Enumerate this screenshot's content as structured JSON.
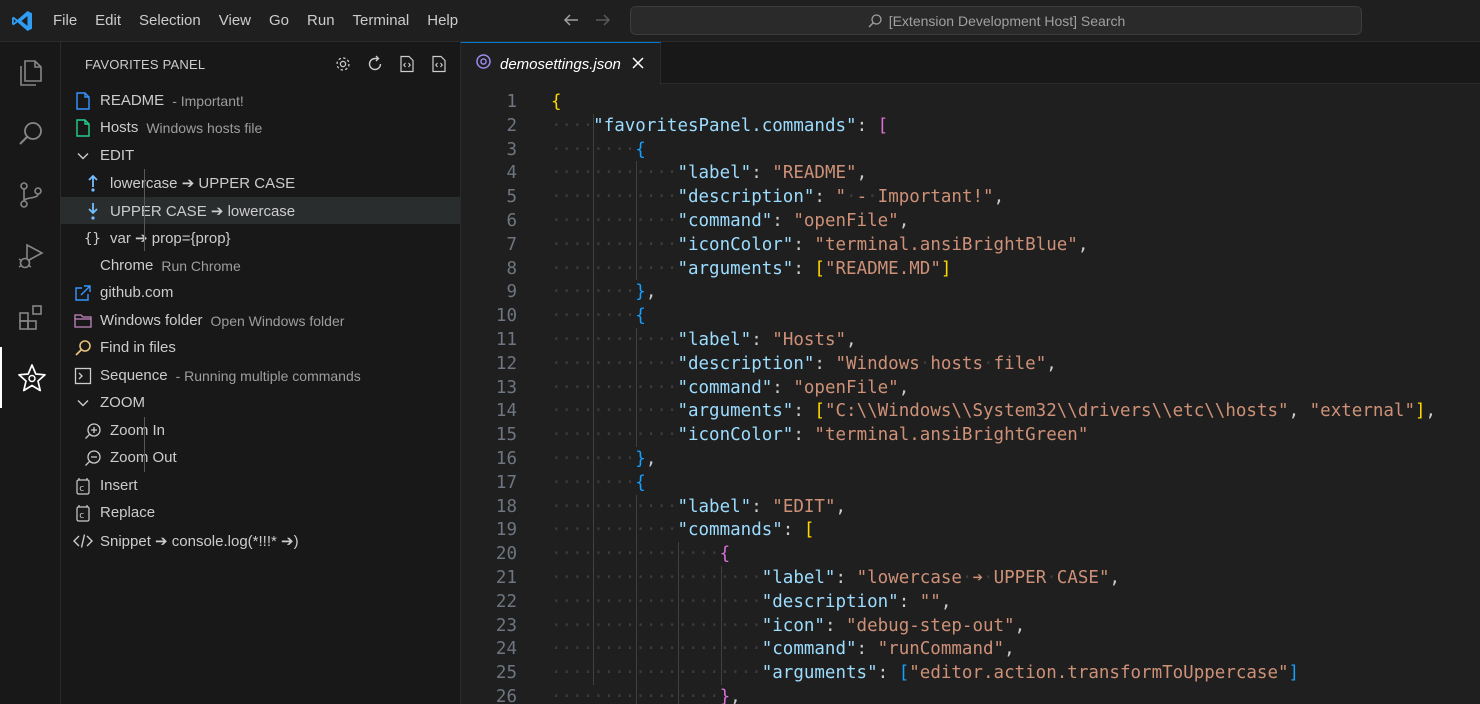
{
  "menu": [
    "File",
    "Edit",
    "Selection",
    "View",
    "Go",
    "Run",
    "Terminal",
    "Help"
  ],
  "search": {
    "placeholder": "[Extension Development Host] Search"
  },
  "activity_bar": [
    "explorer-icon",
    "search-icon",
    "source-control-icon",
    "run-debug-icon",
    "extensions-icon",
    "favorites-star-icon"
  ],
  "sidebar": {
    "title": "FAVORITES PANEL",
    "actions": [
      "gear-icon",
      "refresh-icon",
      "json-file-icon",
      "json-file-alt-icon"
    ],
    "items": [
      {
        "label": "README",
        "description": "- Important!",
        "icon": "file-icon",
        "color": "#3794ff"
      },
      {
        "label": "Hosts",
        "description": "Windows hosts file",
        "icon": "file-icon",
        "color": "#23d18b"
      },
      {
        "label": "EDIT",
        "description": "",
        "icon": "chevron-down-icon"
      },
      {
        "label": "lowercase ➔ UPPER CASE",
        "description": "",
        "icon": "debug-step-out-icon"
      },
      {
        "label": "UPPER CASE ➔ lowercase",
        "description": "",
        "icon": "debug-step-into-icon"
      },
      {
        "label": "var ➔ prop={prop}",
        "description": "",
        "icon": "braces-icon"
      },
      {
        "label": "Chrome",
        "description": "Run Chrome",
        "icon": ""
      },
      {
        "label": "github.com",
        "description": "",
        "icon": "link-external-icon"
      },
      {
        "label": "Windows folder",
        "description": "Open Windows folder",
        "icon": "folder-icon"
      },
      {
        "label": "Find in files",
        "description": "",
        "icon": "search-icon"
      },
      {
        "label": "Sequence",
        "description": "- Running multiple commands",
        "icon": "terminal-icon"
      },
      {
        "label": "ZOOM",
        "description": "",
        "icon": "chevron-down-icon"
      },
      {
        "label": "Zoom In",
        "description": "",
        "icon": "zoom-in-icon"
      },
      {
        "label": "Zoom Out",
        "description": "",
        "icon": "zoom-out-icon"
      },
      {
        "label": "Insert",
        "description": "",
        "icon": "insert-icon"
      },
      {
        "label": "Replace",
        "description": "",
        "icon": "replace-icon"
      },
      {
        "label": "Snippet ➔ console.log(*!!!* ➔)",
        "description": "",
        "icon": "code-icon"
      }
    ]
  },
  "editor": {
    "tab_label": "demosettings.json",
    "lines": [
      [
        [
          "b1",
          "{"
        ]
      ],
      [
        [
          "key",
          "\"favoritesPanel.commands\""
        ],
        [
          "p",
          ": "
        ],
        [
          "b2",
          "["
        ]
      ],
      [
        [
          "b3",
          "{"
        ]
      ],
      [
        [
          "key",
          "\"label\""
        ],
        [
          "p",
          ": "
        ],
        [
          "str",
          "\"README\""
        ],
        [
          "p",
          ","
        ]
      ],
      [
        [
          "key",
          "\"description\""
        ],
        [
          "p",
          ": "
        ],
        [
          "str",
          "\" - Important!\""
        ],
        [
          "p",
          ","
        ]
      ],
      [
        [
          "key",
          "\"command\""
        ],
        [
          "p",
          ": "
        ],
        [
          "str",
          "\"openFile\""
        ],
        [
          "p",
          ","
        ]
      ],
      [
        [
          "key",
          "\"iconColor\""
        ],
        [
          "p",
          ": "
        ],
        [
          "str",
          "\"terminal.ansiBrightBlue\""
        ],
        [
          "p",
          ","
        ]
      ],
      [
        [
          "key",
          "\"arguments\""
        ],
        [
          "p",
          ": "
        ],
        [
          "b1",
          "["
        ],
        [
          "str",
          "\"README.MD\""
        ],
        [
          "b1",
          "]"
        ]
      ],
      [
        [
          "b3",
          "}"
        ],
        [
          "p",
          ","
        ]
      ],
      [
        [
          "b3",
          "{"
        ]
      ],
      [
        [
          "key",
          "\"label\""
        ],
        [
          "p",
          ": "
        ],
        [
          "str",
          "\"Hosts\""
        ],
        [
          "p",
          ","
        ]
      ],
      [
        [
          "key",
          "\"description\""
        ],
        [
          "p",
          ": "
        ],
        [
          "str",
          "\"Windows hosts file\""
        ],
        [
          "p",
          ","
        ]
      ],
      [
        [
          "key",
          "\"command\""
        ],
        [
          "p",
          ": "
        ],
        [
          "str",
          "\"openFile\""
        ],
        [
          "p",
          ","
        ]
      ],
      [
        [
          "key",
          "\"arguments\""
        ],
        [
          "p",
          ": "
        ],
        [
          "b1",
          "["
        ],
        [
          "str",
          "\"C:\\\\Windows\\\\System32\\\\drivers\\\\etc\\\\hosts\""
        ],
        [
          "p",
          ", "
        ],
        [
          "str",
          "\"external\""
        ],
        [
          "b1",
          "]"
        ],
        [
          "p",
          ","
        ]
      ],
      [
        [
          "key",
          "\"iconColor\""
        ],
        [
          "p",
          ": "
        ],
        [
          "str",
          "\"terminal.ansiBrightGreen\""
        ]
      ],
      [
        [
          "b3",
          "}"
        ],
        [
          "p",
          ","
        ]
      ],
      [
        [
          "b3",
          "{"
        ]
      ],
      [
        [
          "key",
          "\"label\""
        ],
        [
          "p",
          ": "
        ],
        [
          "str",
          "\"EDIT\""
        ],
        [
          "p",
          ","
        ]
      ],
      [
        [
          "key",
          "\"commands\""
        ],
        [
          "p",
          ": "
        ],
        [
          "b1",
          "["
        ]
      ],
      [
        [
          "b2",
          "{"
        ]
      ],
      [
        [
          "key",
          "\"label\""
        ],
        [
          "p",
          ": "
        ],
        [
          "str",
          "\"lowercase ➔ UPPER CASE\""
        ],
        [
          "p",
          ","
        ]
      ],
      [
        [
          "key",
          "\"description\""
        ],
        [
          "p",
          ": "
        ],
        [
          "str",
          "\"\""
        ],
        [
          "p",
          ","
        ]
      ],
      [
        [
          "key",
          "\"icon\""
        ],
        [
          "p",
          ": "
        ],
        [
          "str",
          "\"debug-step-out\""
        ],
        [
          "p",
          ","
        ]
      ],
      [
        [
          "key",
          "\"command\""
        ],
        [
          "p",
          ": "
        ],
        [
          "str",
          "\"runCommand\""
        ],
        [
          "p",
          ","
        ]
      ],
      [
        [
          "key",
          "\"arguments\""
        ],
        [
          "p",
          ": "
        ],
        [
          "b3",
          "["
        ],
        [
          "str",
          "\"editor.action.transformToUppercase\""
        ],
        [
          "b3",
          "]"
        ]
      ],
      [
        [
          "b2",
          "}"
        ],
        [
          "p",
          ","
        ]
      ]
    ]
  }
}
